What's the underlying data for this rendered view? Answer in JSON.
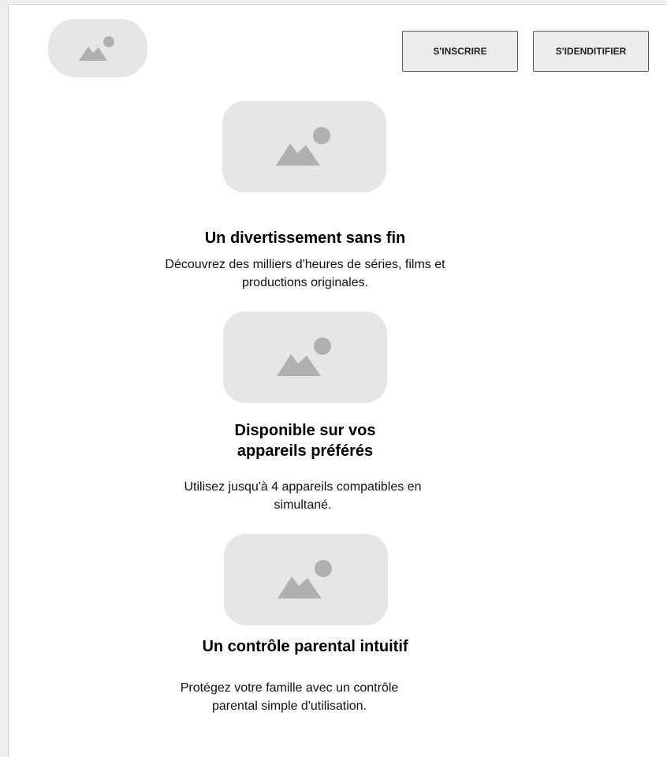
{
  "header": {
    "logo_icon": "image-placeholder-icon",
    "signup_label": "S'INSCRIRE",
    "login_label": "S'IDENDITIFIER"
  },
  "features": [
    {
      "icon": "image-placeholder-icon",
      "title": "Un divertissement sans fin",
      "description": "Découvrez des milliers d'heures de séries, films et productions originales."
    },
    {
      "icon": "image-placeholder-icon",
      "title": "Disponible sur vos appareils préférés",
      "description": "Utilisez jusqu'à 4 appareils compatibles en simultané."
    },
    {
      "icon": "image-placeholder-icon",
      "title": "Un contrôle parental intuitif",
      "description": "Protégez votre famille avec un contrôle parental simple d'utilisation."
    }
  ],
  "colors": {
    "placeholder_bg": "#e6e6e6",
    "placeholder_icon": "#b0b0b0",
    "button_bg": "#ececec",
    "button_border": "#5a5a5a"
  }
}
